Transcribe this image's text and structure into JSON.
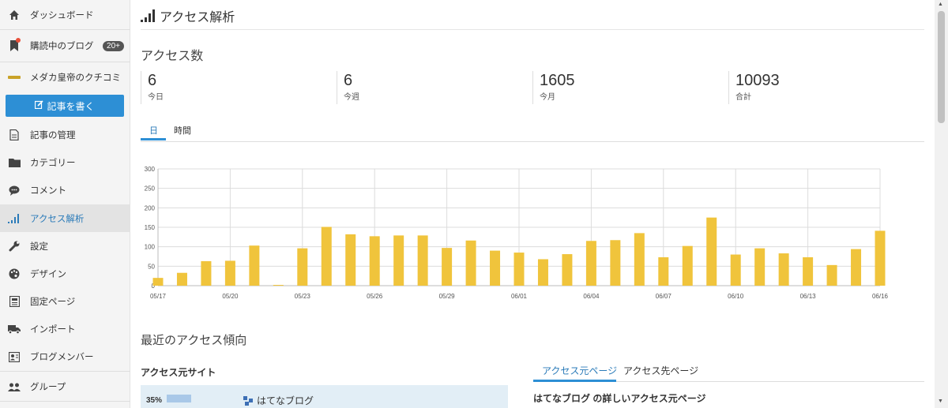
{
  "sidebar": {
    "items": [
      {
        "label": "ダッシュボード",
        "icon": "home-icon"
      },
      {
        "label": "購読中のブログ",
        "icon": "bookmark-icon",
        "badge": "20+"
      },
      {
        "label": "メダカ皇帝のクチコミ",
        "icon": "blog-icon"
      },
      {
        "label": "記事の管理",
        "icon": "document-icon"
      },
      {
        "label": "カテゴリー",
        "icon": "folder-icon"
      },
      {
        "label": "コメント",
        "icon": "comment-icon"
      },
      {
        "label": "アクセス解析",
        "icon": "bar-chart-icon",
        "active": true
      },
      {
        "label": "設定",
        "icon": "wrench-icon"
      },
      {
        "label": "デザイン",
        "icon": "palette-icon"
      },
      {
        "label": "固定ページ",
        "icon": "page-icon"
      },
      {
        "label": "インポート",
        "icon": "truck-icon"
      },
      {
        "label": "ブログメンバー",
        "icon": "member-icon"
      },
      {
        "label": "グループ",
        "icon": "group-icon"
      }
    ],
    "write_button": "記事を書く"
  },
  "header": {
    "title": "アクセス解析"
  },
  "access": {
    "heading": "アクセス数",
    "stats": [
      {
        "value": "6",
        "label": "今日"
      },
      {
        "value": "6",
        "label": "今週"
      },
      {
        "value": "1605",
        "label": "今月"
      },
      {
        "value": "10093",
        "label": "合計"
      }
    ],
    "tabs": [
      "日",
      "時間"
    ]
  },
  "colors": {
    "bar": "#f0c43c",
    "accent": "#2d8fd5",
    "active_text": "#2b7bb9"
  },
  "chart_data": {
    "type": "bar",
    "categories": [
      "05/17",
      "05/18",
      "05/19",
      "05/20",
      "05/21",
      "05/22",
      "05/23",
      "05/24",
      "05/25",
      "05/26",
      "05/27",
      "05/28",
      "05/29",
      "05/30",
      "05/31",
      "06/01",
      "06/02",
      "06/03",
      "06/04",
      "06/05",
      "06/06",
      "06/07",
      "06/08",
      "06/09",
      "06/10",
      "06/11",
      "06/12",
      "06/13",
      "06/14",
      "06/15",
      "06/16"
    ],
    "tick_labels": [
      "05/17",
      "05/20",
      "05/23",
      "05/26",
      "05/29",
      "06/01",
      "06/04",
      "06/07",
      "06/10",
      "06/13",
      "06/16"
    ],
    "values": [
      20,
      33,
      63,
      64,
      103,
      2,
      96,
      151,
      132,
      127,
      129,
      129,
      97,
      116,
      90,
      85,
      68,
      81,
      115,
      117,
      135,
      73,
      102,
      175,
      80,
      96,
      83,
      73,
      53,
      94,
      141
    ],
    "ylim": [
      0,
      300
    ],
    "yticks": [
      0,
      50,
      100,
      150,
      200,
      250,
      300
    ],
    "grid": true
  },
  "recent": {
    "heading": "最近のアクセス傾向",
    "ref_sites_title": "アクセス元サイト",
    "ref_sites": [
      {
        "percent": "35%",
        "share": 0.35,
        "site": "はてなブログ"
      }
    ],
    "tabs": [
      "アクセス元ページ",
      "アクセス先ページ"
    ],
    "detail_title": "はてなブログ の詳しいアクセス元ページ"
  }
}
